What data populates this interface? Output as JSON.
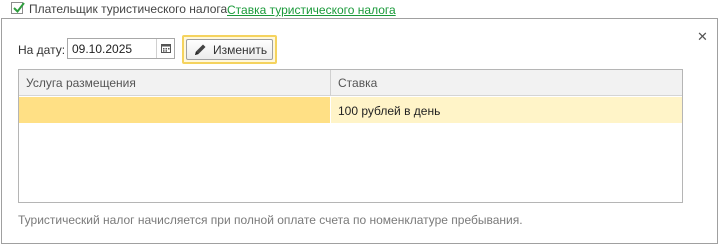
{
  "header": {
    "tax_payer_checkbox": {
      "label": "Плательщик туристического налога",
      "checked": true
    },
    "rate_link": "Ставка туристического налога"
  },
  "dialog": {
    "close_icon": "close-icon",
    "date": {
      "label": "На дату:",
      "value": "09.10.2025",
      "icon": "calendar-icon"
    },
    "edit_button": {
      "label": "Изменить",
      "icon": "pencil-icon"
    },
    "table": {
      "columns": [
        "Услуга размещения",
        "Ставка"
      ],
      "rows": [
        {
          "service": "",
          "rate": "100 рублей в день"
        }
      ]
    },
    "footnote": "Туристический налог начисляется при полной оплате счета по номенклатуре пребывания."
  },
  "colors": {
    "link": "#1a9a3a",
    "check": "#2e9e3e",
    "selected_row": "#ffe085",
    "selected_row_alt": "#fff4c8",
    "focus_border": "#f5d35e"
  }
}
